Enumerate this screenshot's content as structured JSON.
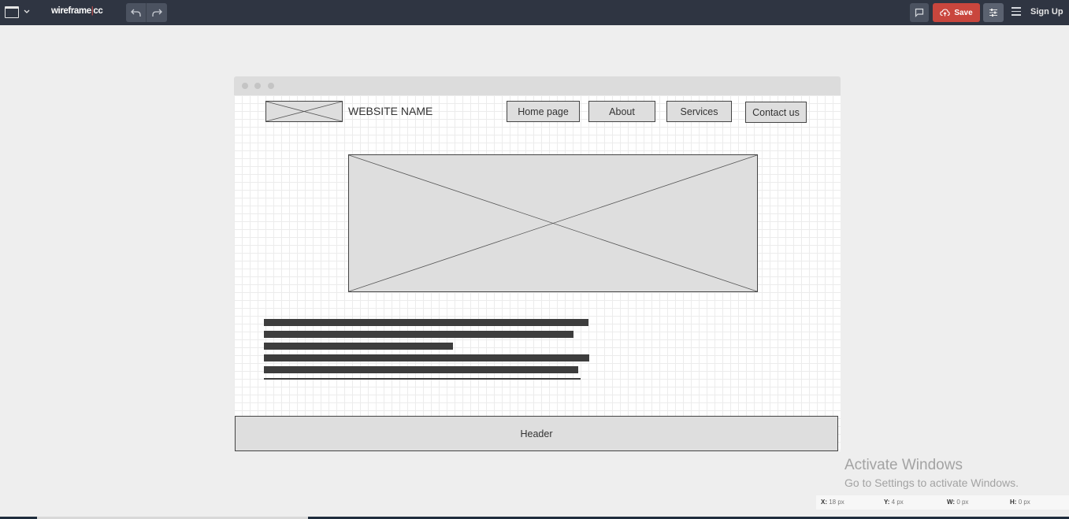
{
  "toolbar": {
    "brand_main": "wireframe",
    "brand_sep": "|",
    "brand_suffix": "cc",
    "save_label": "Save",
    "signup_label": "Sign Up",
    "icons": [
      "page-window-icon",
      "chevron-down-icon",
      "undo-icon",
      "redo-icon",
      "comment-icon",
      "cloud-upload-icon",
      "settings-sliders-icon",
      "hamburger-menu-icon"
    ],
    "save_color": "#c9463d",
    "bar_color": "#2f3542"
  },
  "wireframe": {
    "site_name": "WEBSITE NAME",
    "nav": [
      "Home page",
      "About",
      "Services",
      "Contact us"
    ],
    "footer_label": "Header"
  },
  "windows_watermark": {
    "title": "Activate Windows",
    "subtitle": "Go to Settings to activate Windows."
  },
  "status": {
    "x_label": "X:",
    "x_value": "18 px",
    "y_label": "Y:",
    "y_value": "4 px",
    "w_label": "W:",
    "w_value": "0 px",
    "h_label": "H:",
    "h_value": "0 px"
  }
}
